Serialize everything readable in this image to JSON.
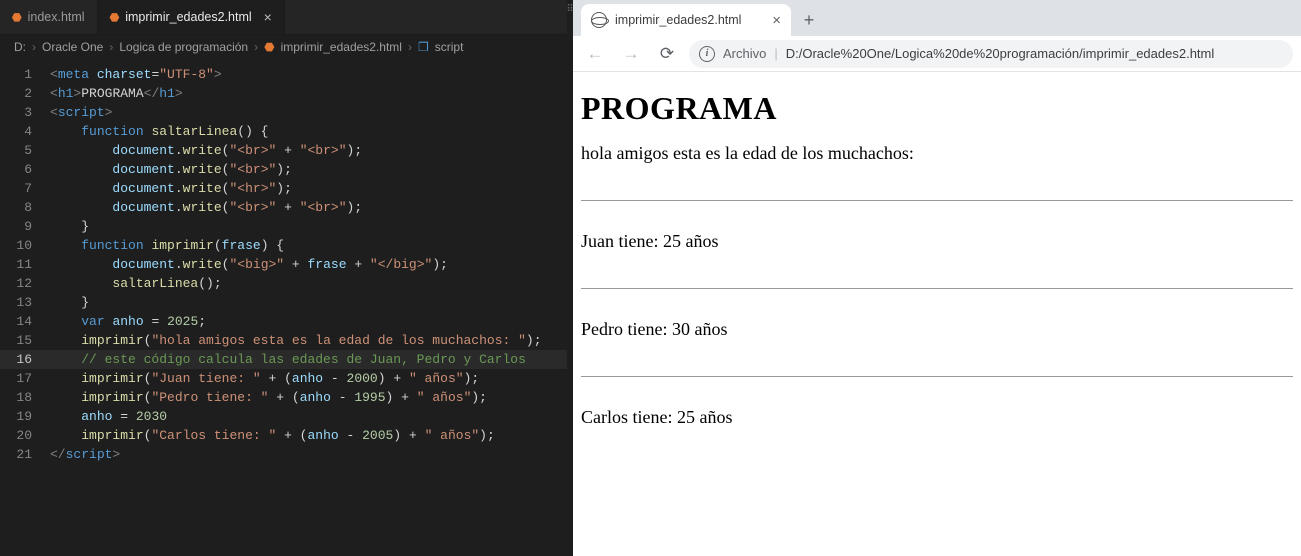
{
  "editor": {
    "tabs": [
      {
        "label": "index.html",
        "active": false
      },
      {
        "label": "imprimir_edades2.html",
        "active": true
      }
    ],
    "breadcrumbs": {
      "drive": "D:",
      "p1": "Oracle One",
      "p2": "Logica de programación",
      "file": "imprimir_edades2.html",
      "symbol": "script"
    },
    "code": {
      "l1": {
        "a": "<",
        "b": "meta ",
        "c": "charset",
        "d": "=",
        "e": "\"UTF-8\"",
        "f": ">"
      },
      "l2": {
        "a": "<",
        "b": "h1",
        "c": ">",
        "d": "PROGRAMA",
        "e": "</",
        "f": "h1",
        "g": ">"
      },
      "l3": {
        "a": "<",
        "b": "script",
        "c": ">"
      },
      "l4": {
        "a": "function ",
        "b": "saltarLinea",
        "c": "() {"
      },
      "l5": {
        "a": "document",
        "b": ".",
        "c": "write",
        "d": "(",
        "e": "\"<br>\"",
        "f": " + ",
        "g": "\"<br>\"",
        "h": ");"
      },
      "l6": {
        "a": "document",
        "b": ".",
        "c": "write",
        "d": "(",
        "e": "\"<br>\"",
        "f": ");"
      },
      "l7": {
        "a": "document",
        "b": ".",
        "c": "write",
        "d": "(",
        "e": "\"<hr>\"",
        "f": ");"
      },
      "l8": {
        "a": "document",
        "b": ".",
        "c": "write",
        "d": "(",
        "e": "\"<br>\"",
        "f": " + ",
        "g": "\"<br>\"",
        "h": ");"
      },
      "l9": {
        "a": "}"
      },
      "l10": {
        "a": "function ",
        "b": "imprimir",
        "c": "(",
        "d": "frase",
        "e": ") {"
      },
      "l11": {
        "a": "document",
        "b": ".",
        "c": "write",
        "d": "(",
        "e": "\"<big>\"",
        "f": " + ",
        "g": "frase",
        "h": " + ",
        "i": "\"</big>\"",
        "j": ");"
      },
      "l12": {
        "a": "saltarLinea",
        "b": "();"
      },
      "l13": {
        "a": "}"
      },
      "l14": {
        "a": "var ",
        "b": "anho",
        "c": " = ",
        "d": "2025",
        "e": ";"
      },
      "l15": {
        "a": "imprimir",
        "b": "(",
        "c": "\"hola amigos esta es la edad de los muchachos: \"",
        "d": ");"
      },
      "l16": {
        "a": "// este código calcula las edades de Juan, Pedro y Carlos"
      },
      "l17": {
        "a": "imprimir",
        "b": "(",
        "c": "\"Juan tiene: \"",
        "d": " + (",
        "e": "anho",
        "f": " - ",
        "g": "2000",
        "h": ") + ",
        "i": "\" años\"",
        "j": ");"
      },
      "l18": {
        "a": "imprimir",
        "b": "(",
        "c": "\"Pedro tiene: \"",
        "d": " + (",
        "e": "anho",
        "f": " - ",
        "g": "1995",
        "h": ") + ",
        "i": "\" años\"",
        "j": ");"
      },
      "l19": {
        "a": "anho",
        "b": " = ",
        "c": "2030"
      },
      "l20": {
        "a": "imprimir",
        "b": "(",
        "c": "\"Carlos tiene: \"",
        "d": " + (",
        "e": "anho",
        "f": " - ",
        "g": "2005",
        "h": ") + ",
        "i": "\" años\"",
        "j": ");"
      },
      "l21": {
        "a": "</",
        "b": "script",
        "c": ">"
      }
    },
    "gutter": {
      "n1": "1",
      "n2": "2",
      "n3": "3",
      "n4": "4",
      "n5": "5",
      "n6": "6",
      "n7": "7",
      "n8": "8",
      "n9": "9",
      "n10": "10",
      "n11": "11",
      "n12": "12",
      "n13": "13",
      "n14": "14",
      "n15": "15",
      "n16": "16",
      "n17": "17",
      "n18": "18",
      "n19": "19",
      "n20": "20",
      "n21": "21"
    }
  },
  "browser": {
    "tab_title": "imprimir_edades2.html",
    "addr_label": "Archivo",
    "addr_url": "D:/Oracle%20One/Logica%20de%20programación/imprimir_edades2.html",
    "page": {
      "h1": "PROGRAMA",
      "p0": "hola amigos esta es la edad de los muchachos:",
      "p1": "Juan tiene: 25 años",
      "p2": "Pedro tiene: 30 años",
      "p3": "Carlos tiene: 25 años"
    }
  }
}
